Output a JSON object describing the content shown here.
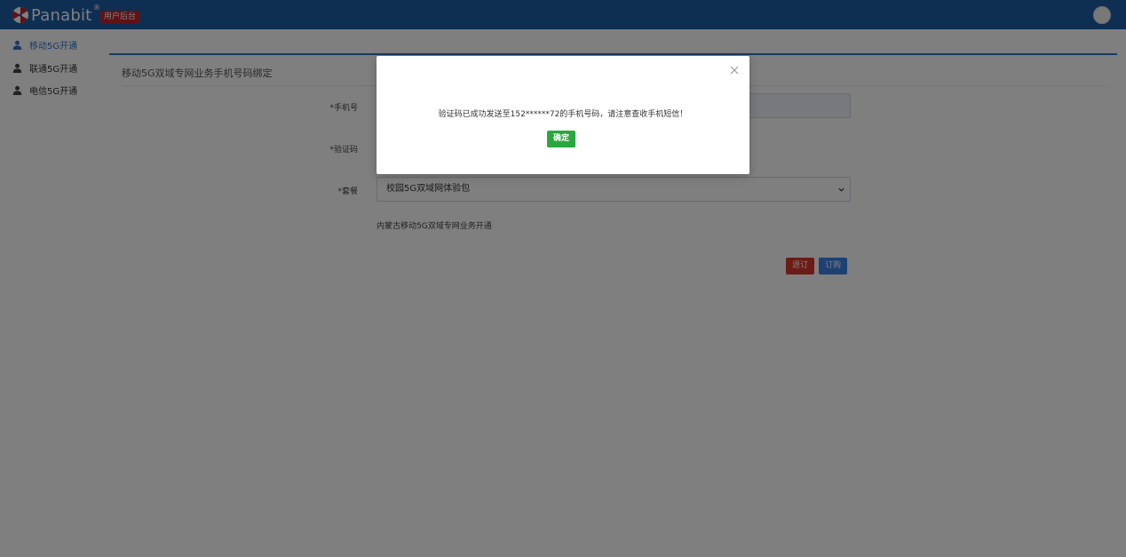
{
  "header": {
    "logo_text": "Panabit",
    "logo_reg": "®",
    "admin_badge": "用户后台"
  },
  "sidebar": {
    "items": [
      {
        "label": "移动5G开通",
        "icon": "user-icon",
        "active": true
      },
      {
        "label": "联通5G开通",
        "icon": "user-icon",
        "active": false
      },
      {
        "label": "电信5G开通",
        "icon": "user-icon",
        "active": false
      }
    ]
  },
  "panel": {
    "title": "移动5G双域专网业务手机号码绑定",
    "phone_label": "*手机号",
    "phone_value": "",
    "code_label": "*验证码",
    "plan_label": "*套餐",
    "plan_selected": "校园5G双域网体验包",
    "description": "内蒙古移动5G双域专网业务开通",
    "unsubscribe_label": "退订",
    "subscribe_label": "订购"
  },
  "modal": {
    "message": "验证码已成功发送至152******72的手机号码，请注意查收手机短信！",
    "ok_label": "确定"
  },
  "colors": {
    "header_bg": "#1f5fa5",
    "badge_red": "#c0242c",
    "accent_blue": "#2f74c8",
    "btn_red": "#d9382f",
    "btn_blue": "#3b82e4",
    "btn_green": "#2aa83e"
  }
}
